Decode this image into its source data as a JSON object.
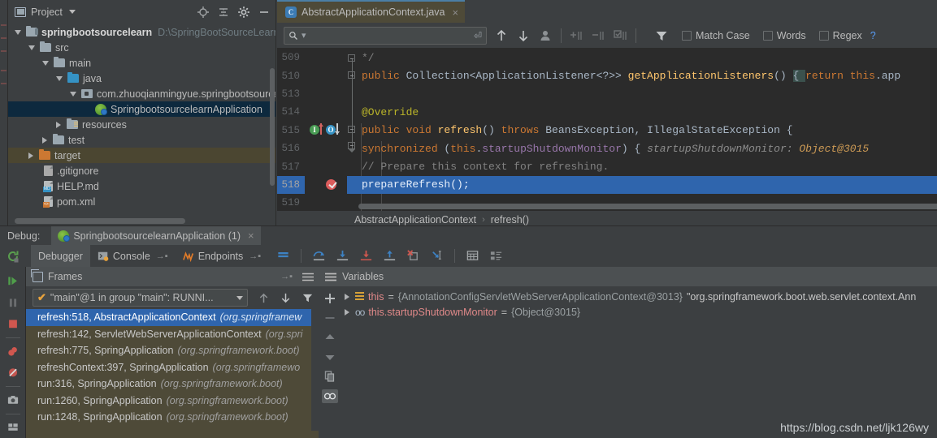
{
  "project": {
    "title": "Project",
    "icons": [
      "locate-icon",
      "collapse-all-icon",
      "settings-gear-icon",
      "minimize-icon"
    ],
    "tree": [
      {
        "label": "springbootsourcelearn",
        "path": "D:\\SpringBootSourceLearn",
        "depth": 0,
        "icon": "module-folder-icon",
        "expanded": true,
        "bold": true
      },
      {
        "label": "src",
        "depth": 1,
        "icon": "folder-icon",
        "expanded": true
      },
      {
        "label": "main",
        "depth": 2,
        "icon": "folder-icon",
        "expanded": true
      },
      {
        "label": "java",
        "depth": 3,
        "icon": "source-folder-icon",
        "expanded": true
      },
      {
        "label": "com.zhuoqianmingyue.springbootsourcelearn",
        "depth": 4,
        "icon": "package-icon",
        "expanded": true
      },
      {
        "label": "SpringbootsourcelearnApplication",
        "depth": 5,
        "icon": "spring-bean-icon",
        "selected": true
      },
      {
        "label": "resources",
        "depth": 3,
        "icon": "resources-folder-icon",
        "collapsed": true
      },
      {
        "label": "test",
        "depth": 2,
        "icon": "folder-icon",
        "collapsed": true
      },
      {
        "label": "target",
        "depth": 1,
        "icon": "excluded-folder-icon",
        "collapsed": true,
        "highlighted": true
      },
      {
        "label": ".gitignore",
        "depth": 2,
        "icon": "file-icon"
      },
      {
        "label": "HELP.md",
        "depth": 2,
        "icon": "markdown-file-icon"
      },
      {
        "label": "pom.xml",
        "depth": 2,
        "icon": "xml-file-icon"
      }
    ]
  },
  "editor": {
    "tab": {
      "label": "AbstractApplicationContext.java",
      "icon": "java-class-icon",
      "close": "×"
    },
    "find": {
      "value": "",
      "placeholder": "",
      "search_icon": "search-icon",
      "enter_icon": "enter-icon",
      "buttons": [
        "find-previous-icon",
        "find-next-icon",
        "select-occurrences-icon",
        "add-line-icon",
        "remove-line-icon",
        "select-all-icon",
        "filter-icon"
      ],
      "match_case": "Match Case",
      "words": "Words",
      "regex": "Regex",
      "help": "?"
    },
    "lines": [
      {
        "num": "509",
        "tokens": [
          {
            "t": "   */",
            "c": "com"
          }
        ],
        "fold": "collapsed-marker"
      },
      {
        "num": "510",
        "tokens": [
          {
            "t": "public ",
            "c": "kw"
          },
          {
            "t": "Collection<ApplicationListener<?>> ",
            "c": "cls"
          },
          {
            "t": "getApplicationListeners",
            "c": "mth"
          },
          {
            "t": "() ",
            "c": "cls"
          },
          {
            "t": "{ ",
            "c": "brace"
          },
          {
            "t": "return ",
            "c": "kw"
          },
          {
            "t": "this",
            "c": "kw"
          },
          {
            "t": ".app",
            "c": "cls"
          }
        ],
        "fold": "plus"
      },
      {
        "num": "513",
        "tokens": []
      },
      {
        "num": "514",
        "tokens": [
          {
            "t": "@Override",
            "c": "ann"
          }
        ]
      },
      {
        "num": "515",
        "tokens": [
          {
            "t": "public void ",
            "c": "kw"
          },
          {
            "t": "refresh",
            "c": "mth"
          },
          {
            "t": "() ",
            "c": "cls"
          },
          {
            "t": "throws ",
            "c": "kw"
          },
          {
            "t": "BeansException, IllegalStateException {",
            "c": "cls"
          }
        ],
        "gutter": [
          "implements-method-icon",
          "overridden-method-icon"
        ],
        "fold": "minus"
      },
      {
        "num": "516",
        "tokens": [
          {
            "t": "    synchronized ",
            "c": "kw"
          },
          {
            "t": "(",
            "c": "cls"
          },
          {
            "t": "this",
            "c": "kw"
          },
          {
            "t": ".",
            "c": "cls"
          },
          {
            "t": "startupShutdownMonitor",
            "c": "fld"
          },
          {
            "t": ") {  ",
            "c": "cls"
          },
          {
            "t": "startupShutdownMonitor: ",
            "c": "inl"
          },
          {
            "t": "Object@3015",
            "c": "inlv"
          }
        ],
        "fold": "minus"
      },
      {
        "num": "517",
        "tokens": [
          {
            "t": "        // Prepare this context for refreshing.",
            "c": "com"
          }
        ]
      },
      {
        "num": "518",
        "tokens": [
          {
            "t": "        prepareRefresh();",
            "c": "cls"
          }
        ],
        "gutter": [
          "breakpoint-verified-icon"
        ],
        "highlighted": true
      },
      {
        "num": "519",
        "tokens": []
      }
    ],
    "breadcrumb": {
      "class": "AbstractApplicationContext",
      "separator": "›",
      "method": "refresh()"
    }
  },
  "debug": {
    "label": "Debug:",
    "run_config": {
      "name": "SpringbootsourcelearnApplication (1)",
      "icon": "spring-boot-icon",
      "close": "×"
    },
    "rerun_icon": "rerun-icon",
    "tabs": [
      {
        "label": "Debugger",
        "icon": "",
        "active": true,
        "pin": ""
      },
      {
        "label": "Console",
        "icon": "console-icon",
        "active": false,
        "pin": "→▪"
      },
      {
        "label": "Endpoints",
        "icon": "endpoints-icon",
        "active": false,
        "pin": "→▪"
      }
    ],
    "toolbar_icons": [
      "layout-icon",
      "step-over-icon",
      "step-into-icon",
      "force-step-into-icon",
      "step-out-icon",
      "drop-frame-icon",
      "run-to-cursor-icon",
      "evaluate-expression-icon",
      "settings-list-icon"
    ],
    "sidebar_icons": [
      "resume-program-icon",
      "pause-program-icon",
      "stop-icon",
      "view-breakpoints-icon",
      "mute-breakpoints-icon",
      "screenshot-icon",
      "layout-settings-icon"
    ],
    "frames": {
      "title": "Frames",
      "pin": "→▪",
      "menu_icon": "menu-icon",
      "thread": {
        "status_icon": "thread-running-check-icon",
        "label": "\"main\"@1 in group \"main\": RUNNI...",
        "caret": "▾"
      },
      "thread_buttons": [
        "frames-up-icon",
        "frames-down-icon",
        "filter-frames-icon"
      ],
      "items": [
        {
          "frame": "refresh:518, AbstractApplicationContext",
          "pkg": "(org.springframew",
          "selected": true
        },
        {
          "frame": "refresh:142, ServletWebServerApplicationContext",
          "pkg": "(org.spri"
        },
        {
          "frame": "refresh:775, SpringApplication",
          "pkg": "(org.springframework.boot)"
        },
        {
          "frame": "refreshContext:397, SpringApplication",
          "pkg": "(org.springframewo"
        },
        {
          "frame": "run:316, SpringApplication",
          "pkg": "(org.springframework.boot)"
        },
        {
          "frame": "run:1260, SpringApplication",
          "pkg": "(org.springframework.boot)"
        },
        {
          "frame": "run:1248, SpringApplication",
          "pkg": "(org.springframework.boot)"
        }
      ]
    },
    "variables": {
      "title": "Variables",
      "icon": "variables-icon",
      "gutter_icons": [
        "add-watch-icon",
        "remove-watch-icon",
        "move-up-icon",
        "move-down-icon",
        "copy-icon",
        "watches-icon"
      ],
      "items": [
        {
          "arrow": "▶",
          "icon": "field-icon",
          "name": "this",
          "eq": "=",
          "value": "{AnnotationConfigServletWebServerApplicationContext@3013}",
          "str": "\"org.springframework.boot.web.servlet.context.Ann"
        },
        {
          "arrow": "▶",
          "icon": "object-icon",
          "name": "this.startupShutdownMonitor",
          "eq": "=",
          "value": "{Object@3015}",
          "str": ""
        }
      ]
    }
  },
  "watermark": "https://blog.csdn.net/ljk126wy",
  "colors": {
    "bg": "#3c3f41",
    "editor_bg": "#2b2b2b",
    "selection_blue": "#2f65ad",
    "tree_selection": "#0d293e",
    "frames_bg": "#4e4a38",
    "accent_keyword": "#cc7832",
    "accent_method": "#ffc66d",
    "accent_field": "#9876aa",
    "accent_annotation": "#bbb529",
    "comment": "#808080"
  }
}
